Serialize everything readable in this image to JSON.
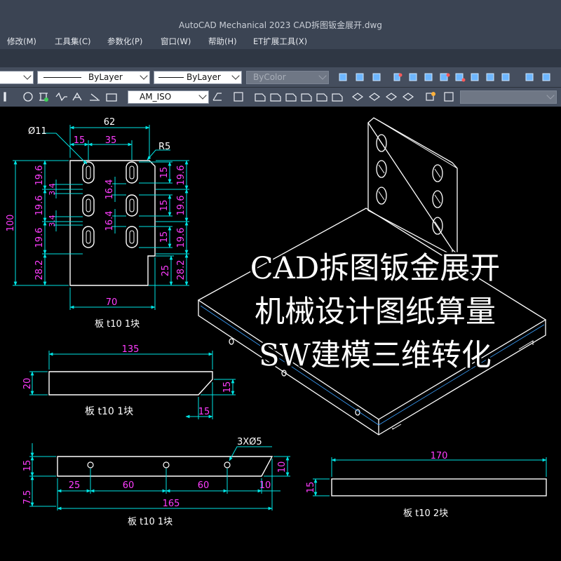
{
  "window": {
    "title": "AutoCAD Mechanical 2023    CAD拆图钣金展开.dwg"
  },
  "menu": [
    {
      "label": "修改(M)",
      "id": "modify"
    },
    {
      "label": "工具集(C)",
      "id": "toolsets"
    },
    {
      "label": "参数化(P)",
      "id": "parametric"
    },
    {
      "label": "窗口(W)",
      "id": "window"
    },
    {
      "label": "帮助(H)",
      "id": "help"
    },
    {
      "label": "ET扩展工具(X)",
      "id": "et-tools"
    }
  ],
  "toolbar": {
    "linetype": "ByLayer",
    "lineweight": "ByLayer",
    "color": "ByColor",
    "dimstyle": "AM_ISO"
  },
  "drawing": {
    "part1": {
      "dims": {
        "width": "62",
        "hole_dia": "Ø11",
        "offset": "15",
        "spacing": "35",
        "radius": "R5",
        "pitch": "19.6",
        "total_height": "100",
        "small": "3.4",
        "slot": "16.4",
        "slot_h": "15",
        "bottom": "28.2",
        "step": "25",
        "base": "70"
      },
      "label": "板 t10 1块"
    },
    "part2": {
      "dims": {
        "length": "135",
        "height": "20",
        "chamfer_v": "15",
        "chamfer_h": "15"
      },
      "label": "板 t10 1块"
    },
    "part3": {
      "dims": {
        "holes": "3XØ5",
        "height": "15",
        "edge": "7.5",
        "first": "25",
        "gap1": "60",
        "gap2": "60",
        "end": "10",
        "end_h": "10",
        "length": "165"
      },
      "label": "板 t10 1块"
    },
    "part4": {
      "dims": {
        "length": "170",
        "height": "15"
      },
      "label": "板 t10 2块"
    }
  },
  "overlay": {
    "line1": "CAD拆图钣金展开",
    "line2": "机械设计图纸算量",
    "line3": "SW建模三维转化"
  },
  "colors": {
    "dim": "#00e5e5",
    "dim_text": "#ff3dff",
    "geometry": "#ffffff",
    "ui_bg": "#3b4453",
    "toolbar_bg": "#454e5e"
  }
}
